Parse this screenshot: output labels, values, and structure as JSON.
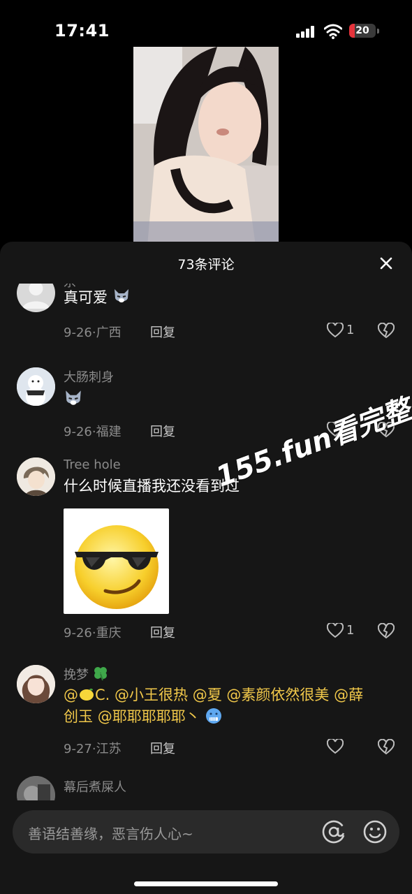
{
  "status_bar": {
    "time": "17:41",
    "battery": "20",
    "battery_level": 0.2
  },
  "sheet": {
    "title": "73条评论",
    "close_icon": "close-icon"
  },
  "comments": [
    {
      "username": "杀''''",
      "text": "真可爱",
      "emoji": "wolf-emoji",
      "date": "9-26·广西",
      "reply": "回复",
      "likes": "1",
      "avatar": "gray-default-avatar"
    },
    {
      "username": "大肠刺身",
      "text": "",
      "emoji": "wolf-emoji",
      "date": "9-26·福建",
      "reply": "回复",
      "likes": "",
      "avatar": "snowman-avatar"
    },
    {
      "username": "Tree hole",
      "text": "什么时候直播我还没看到过",
      "sticker": "cool-sunglasses-emoji",
      "date": "9-26·重庆",
      "reply": "回复",
      "likes": "1",
      "avatar": "anime-boy-avatar"
    },
    {
      "username": "挽梦",
      "username_suffix_icon": "clover-icon",
      "mentions": [
        "@",
        "C.",
        "@小王很热",
        "@夏",
        "@素颜依然很美",
        "@薛",
        "创玉",
        "@耶耶耶耶耶丶"
      ],
      "date": "9-27·江苏",
      "reply": "回复",
      "likes": "",
      "avatar": "anime-girl-avatar"
    },
    {
      "username": "幕后煮屎人",
      "avatar": "dark-avatar"
    }
  ],
  "watermark": {
    "site": "155.fun",
    "text": "看完整版"
  },
  "input": {
    "placeholder": "善语结善缘，恶言伤人心~"
  },
  "colors": {
    "mention": "#f1c84a",
    "background": "#161616",
    "battery": "#e5333b"
  }
}
